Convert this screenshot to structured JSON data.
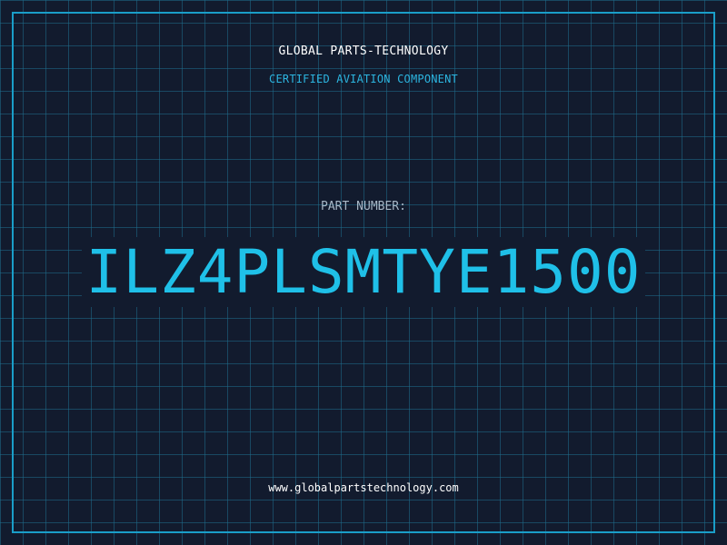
{
  "header": {
    "company": "GLOBAL PARTS-TECHNOLOGY",
    "subtitle": "CERTIFIED AVIATION COMPONENT"
  },
  "part": {
    "label": "PART NUMBER:",
    "number": "ILZ4PLSMTYE1500"
  },
  "footer": {
    "url": "www.globalpartstechnology.com"
  },
  "colors": {
    "background": "#121b2e",
    "grid": "#1f6e8c",
    "frame": "#1a9ec8",
    "accent": "#1fc0e8",
    "label": "#a7b7c6",
    "text": "#ffffff"
  }
}
